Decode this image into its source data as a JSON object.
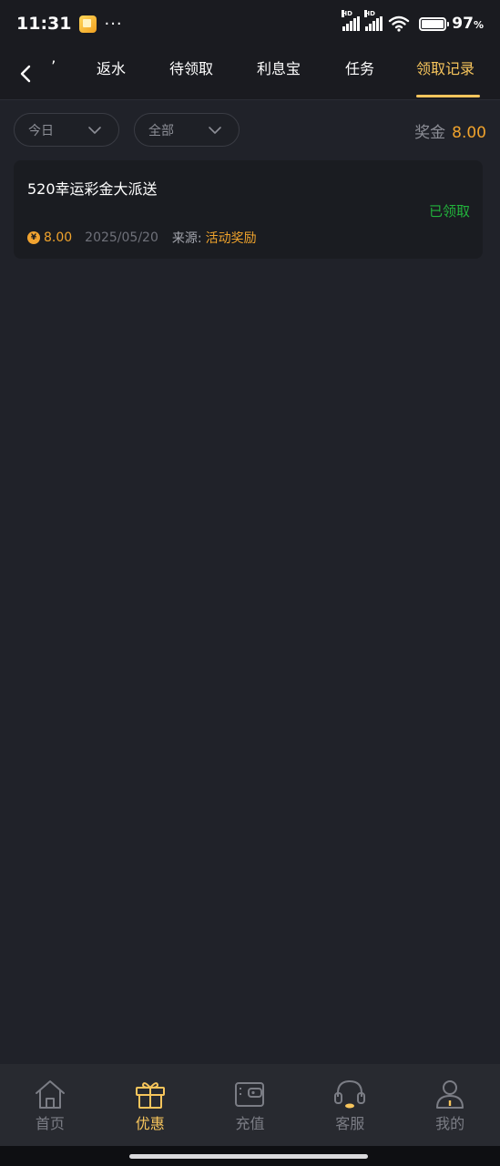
{
  "status_bar": {
    "time": "11:31",
    "dots": "···",
    "battery_text": "97",
    "battery_pct_sign": "%",
    "battery_level": 0.97,
    "network_tags": [
      "HD",
      "HD"
    ]
  },
  "tabs": {
    "partial": "’",
    "items": [
      {
        "label": "返水"
      },
      {
        "label": "待领取"
      },
      {
        "label": "利息宝"
      },
      {
        "label": "任务"
      },
      {
        "label": "领取记录"
      }
    ],
    "active_index": 4
  },
  "filters": {
    "date": "今日",
    "category": "全部"
  },
  "bonus": {
    "label": "奖金",
    "value": "8.00"
  },
  "records": [
    {
      "title": "520幸运彩金大派送",
      "status": "已领取",
      "coin_symbol": "¥",
      "amount": "8.00",
      "date": "2025/05/20",
      "source_label": "来源:",
      "source_value": "活动奖励"
    }
  ],
  "bottom_nav": [
    {
      "label": "首页",
      "icon": "home-icon"
    },
    {
      "label": "优惠",
      "icon": "gift-icon"
    },
    {
      "label": "充值",
      "icon": "wallet-icon"
    },
    {
      "label": "客服",
      "icon": "headset-icon"
    },
    {
      "label": "我的",
      "icon": "user-icon"
    }
  ],
  "colors": {
    "accent": "#f7c55c",
    "amount": "#f0a32c",
    "success": "#22b33c",
    "background": "#202229"
  }
}
